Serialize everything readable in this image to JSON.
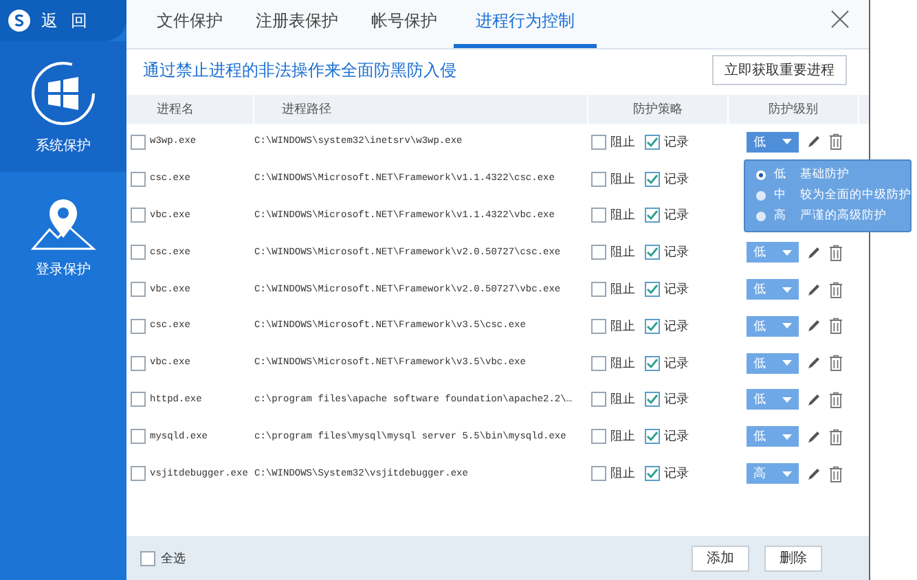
{
  "sidebar": {
    "back": "返 回",
    "items": [
      {
        "label": "系统保护",
        "kind": "windows",
        "selected": true
      },
      {
        "label": "登录保护",
        "kind": "location",
        "selected": false
      }
    ]
  },
  "tabs": [
    {
      "label": "文件保护",
      "selected": false
    },
    {
      "label": "注册表保护",
      "selected": false
    },
    {
      "label": "帐号保护",
      "selected": false
    },
    {
      "label": "进程行为控制",
      "selected": true
    }
  ],
  "description": "通过禁止进程的非法操作来全面防黑防入侵",
  "fetch_button": "立即获取重要进程",
  "table": {
    "columns": [
      "进程名",
      "进程路径",
      "防护策略",
      "防护级别"
    ],
    "rows": [
      {
        "checked": false,
        "name": "w3wp.exe",
        "path": "C:\\WINDOWS\\system32\\inetsrv\\w3wp.exe",
        "block": "阻止",
        "block_checked": false,
        "record": "记录",
        "record_checked": true,
        "level": "低",
        "expanded": true
      },
      {
        "checked": false,
        "name": "csc.exe",
        "path": "C:\\WINDOWS\\Microsoft.NET\\Framework\\v1.1.4322\\csc.exe",
        "block": "阻止",
        "block_checked": false,
        "record": "记录",
        "record_checked": true
      },
      {
        "checked": false,
        "name": "vbc.exe",
        "path": "C:\\WINDOWS\\Microsoft.NET\\Framework\\v1.1.4322\\vbc.exe",
        "block": "阻止",
        "block_checked": false,
        "record": "记录",
        "record_checked": true
      },
      {
        "checked": false,
        "name": "csc.exe",
        "path": "C:\\WINDOWS\\Microsoft.NET\\Framework\\v2.0.50727\\csc.exe",
        "block": "阻止",
        "block_checked": false,
        "record": "记录",
        "record_checked": true,
        "level": "低",
        "expanded": false
      },
      {
        "checked": false,
        "name": "vbc.exe",
        "path": "C:\\WINDOWS\\Microsoft.NET\\Framework\\v2.0.50727\\vbc.exe",
        "block": "阻止",
        "block_checked": false,
        "record": "记录",
        "record_checked": true,
        "level": "低",
        "expanded": false
      },
      {
        "checked": false,
        "name": "csc.exe",
        "path": "C:\\WINDOWS\\Microsoft.NET\\Framework\\v3.5\\csc.exe",
        "block": "阻止",
        "block_checked": false,
        "record": "记录",
        "record_checked": true,
        "level": "低",
        "expanded": false
      },
      {
        "checked": false,
        "name": "vbc.exe",
        "path": "C:\\WINDOWS\\Microsoft.NET\\Framework\\v3.5\\vbc.exe",
        "block": "阻止",
        "block_checked": false,
        "record": "记录",
        "record_checked": true,
        "level": "低",
        "expanded": false
      },
      {
        "checked": false,
        "name": "httpd.exe",
        "path": "c:\\program files\\apache software foundation\\apache2.2\\…",
        "block": "阻止",
        "block_checked": false,
        "record": "记录",
        "record_checked": true,
        "level": "低",
        "expanded": false
      },
      {
        "checked": false,
        "name": "mysqld.exe",
        "path": "c:\\program files\\mysql\\mysql server 5.5\\bin\\mysqld.exe",
        "block": "阻止",
        "block_checked": false,
        "record": "记录",
        "record_checked": true,
        "level": "低",
        "expanded": false
      },
      {
        "checked": false,
        "name": "vsjitdebugger.exe",
        "path": "C:\\WINDOWS\\System32\\vsjitdebugger.exe",
        "block": "阻止",
        "block_checked": false,
        "record": "记录",
        "record_checked": true,
        "level": "高",
        "expanded": false
      }
    ]
  },
  "level_menu": [
    {
      "level": "低",
      "description": "基础防护",
      "selected": true
    },
    {
      "level": "中",
      "description": "较为全面的中级防护",
      "selected": false
    },
    {
      "level": "高",
      "description": "严谨的高级防护",
      "selected": false
    }
  ],
  "footer": {
    "select_all": "全选",
    "select_all_checked": false,
    "buttons": [
      "添加",
      "删除"
    ]
  }
}
